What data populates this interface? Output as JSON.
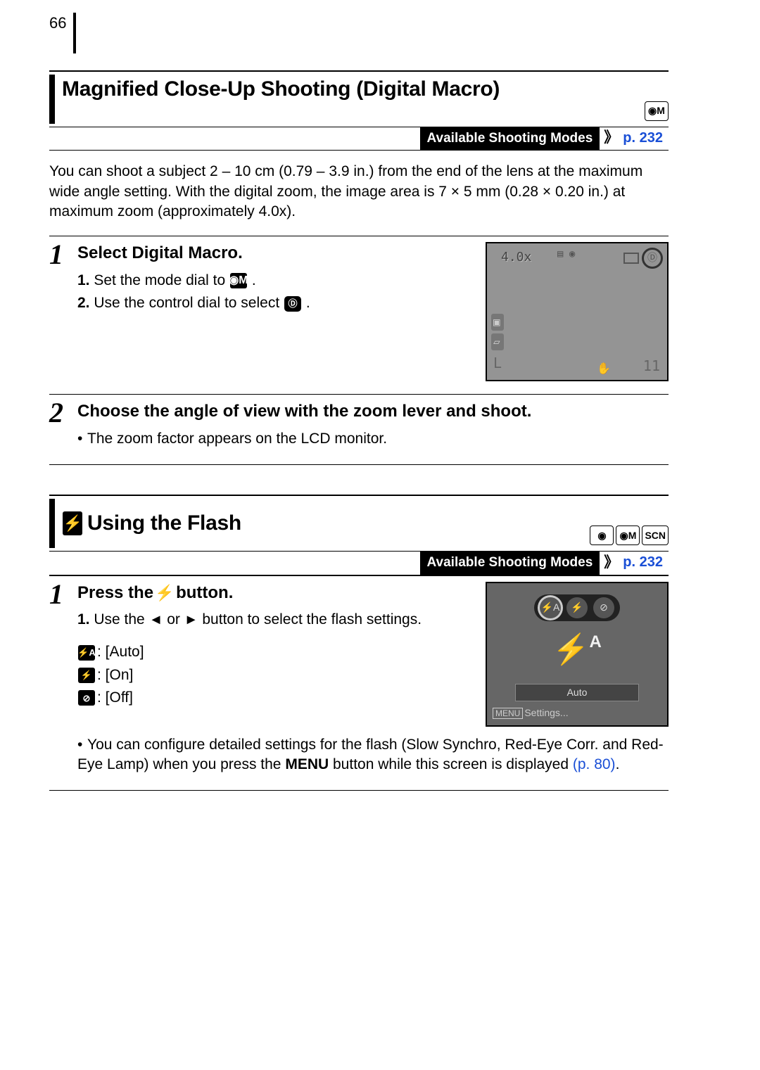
{
  "page_number": "66",
  "section1": {
    "title": "Magnified Close-Up Shooting (Digital Macro)",
    "mode_badge": "M",
    "avail_label": "Available Shooting Modes",
    "avail_ref": "p. 232",
    "intro": "You can shoot a subject 2 – 10 cm (0.79 – 3.9 in.) from the end of the lens at the maximum wide angle setting. With the digital zoom, the image area is 7 × 5 mm (0.28 × 0.20 in.) at maximum zoom (approximately 4.0x).",
    "step1": {
      "num": "1",
      "title": "Select Digital Macro.",
      "line1_pre": "Set the mode dial to ",
      "line1_post": ".",
      "line2_pre": "Use the control dial to select ",
      "line2_post": "."
    },
    "step1_lcd": {
      "zoom": "4.0x",
      "shots": "11",
      "size": "L"
    },
    "step2": {
      "num": "2",
      "title": "Choose the angle of view with the zoom lever and shoot.",
      "bullet": "The zoom factor appears on the LCD monitor."
    }
  },
  "section2": {
    "title": "Using the Flash",
    "mode_badges": [
      "",
      "M",
      "SCN"
    ],
    "avail_label": "Available Shooting Modes",
    "avail_ref": "p. 232",
    "step1": {
      "num": "1",
      "title_pre": "Press the ",
      "title_post": " button.",
      "line1_pre": "Use the ",
      "line1_mid": " or ",
      "line1_post": " button to select the flash settings.",
      "modes": {
        "auto": ": [Auto]",
        "on": ": [On]",
        "off": ": [Off]"
      },
      "note_pre": "You can configure detailed settings for the flash (Slow Synchro, Red-Eye Corr. and Red-Eye Lamp) when you press the ",
      "note_menu": "MENU",
      "note_mid": " button while this screen is displayed ",
      "note_ref": "(p. 80)",
      "note_post": "."
    },
    "step1_lcd": {
      "auto_label": "Auto",
      "menu_label": "MENU",
      "settings_label": "Settings..."
    }
  }
}
